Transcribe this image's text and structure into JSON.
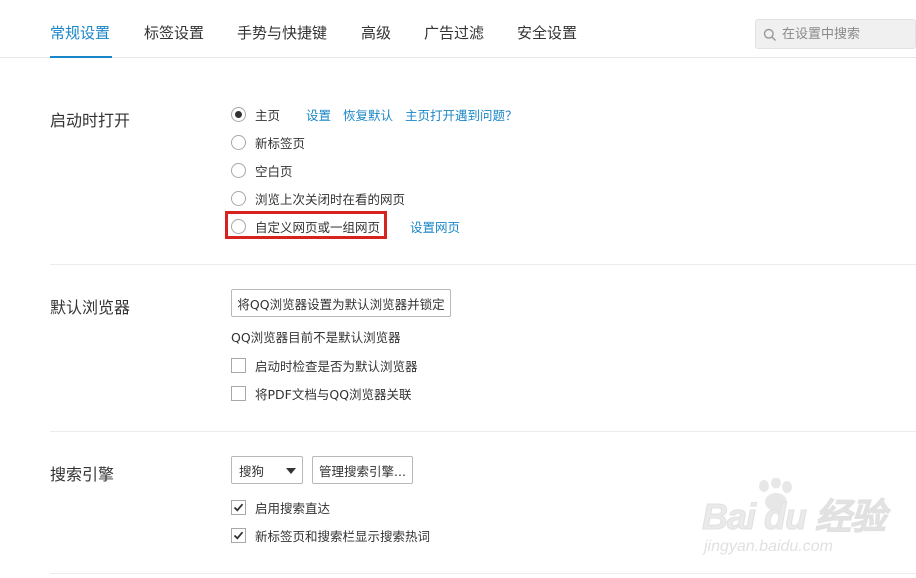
{
  "tabs": [
    {
      "label": "常规设置",
      "active": true
    },
    {
      "label": "标签设置",
      "active": false
    },
    {
      "label": "手势与快捷键",
      "active": false
    },
    {
      "label": "高级",
      "active": false
    },
    {
      "label": "广告过滤",
      "active": false
    },
    {
      "label": "安全设置",
      "active": false
    }
  ],
  "search": {
    "placeholder": "在设置中搜索",
    "icon": "search-icon"
  },
  "startup": {
    "title": "启动时打开",
    "options": [
      {
        "label": "主页",
        "checked": true
      },
      {
        "label": "新标签页",
        "checked": false
      },
      {
        "label": "空白页",
        "checked": false
      },
      {
        "label": "浏览上次关闭时在看的网页",
        "checked": false
      },
      {
        "label": "自定义网页或一组网页",
        "checked": false
      }
    ],
    "home_links": {
      "settings": "设置",
      "restore": "恢复默认",
      "problem": "主页打开遇到问题？"
    },
    "custom_link": "设置网页",
    "highlight_color": "#d6231f"
  },
  "default_browser": {
    "title": "默认浏览器",
    "set_button": "将QQ浏览器设置为默认浏览器并锁定",
    "status": "QQ浏览器目前不是默认浏览器",
    "checkboxes": [
      {
        "label": "启动时检查是否为默认浏览器",
        "checked": false
      },
      {
        "label": "将PDF文档与QQ浏览器关联",
        "checked": false
      }
    ]
  },
  "search_engine": {
    "title": "搜索引擎",
    "selected": "搜狗",
    "manage_button": "管理搜索引擎...",
    "checkboxes": [
      {
        "label": "启用搜索直达",
        "checked": true
      },
      {
        "label": "新标签页和搜索栏显示搜索热词",
        "checked": true
      }
    ]
  },
  "watermark": {
    "main": "Bai du 经验",
    "sub": "jingyan.baidu.com"
  },
  "colors": {
    "accent": "#1a86c8",
    "text": "#333333",
    "divider": "#ececec"
  }
}
